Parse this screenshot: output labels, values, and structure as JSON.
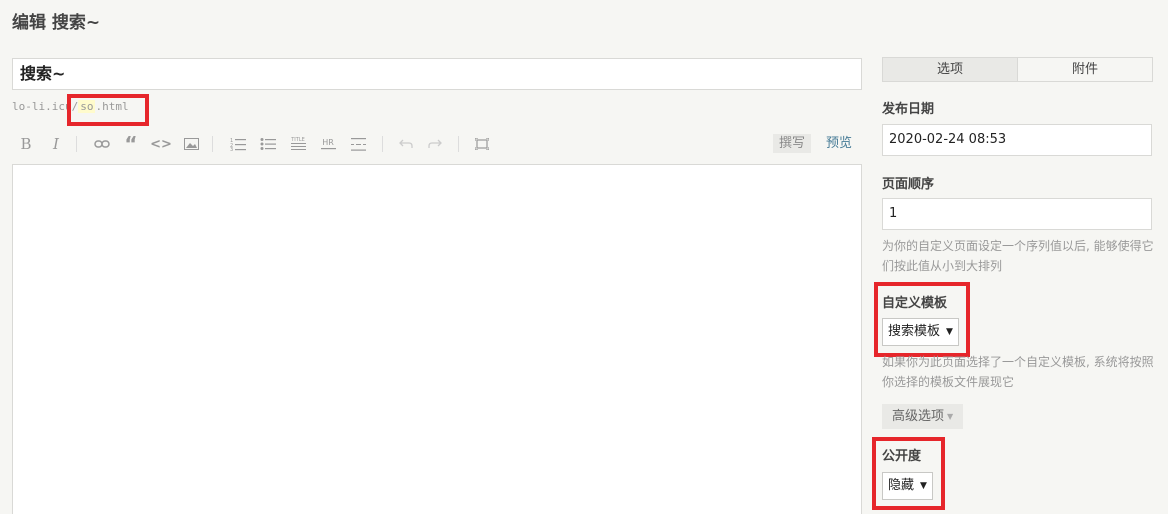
{
  "header": {
    "title": "编辑 搜索~"
  },
  "editor": {
    "title_value": "搜索~",
    "slug_prefix": "lo-li.icu/",
    "slug_value": "so",
    "slug_suffix": ".html",
    "toolbar": {
      "bold": "B",
      "italic": "I",
      "quote": "“",
      "code": "<>",
      "heading": "TITLE",
      "hr": "HR",
      "write_label": "撰写",
      "preview_label": "预览"
    },
    "content": ""
  },
  "sidebar": {
    "tabs": [
      {
        "label": "选项",
        "active": true
      },
      {
        "label": "附件",
        "active": false
      }
    ],
    "publish_date_label": "发布日期",
    "publish_date_value": "2020-02-24 08:53",
    "order_label": "页面顺序",
    "order_value": "1",
    "order_desc": "为你的自定义页面设定一个序列值以后, 能够使得它们按此值从小到大排列",
    "template_label": "自定义模板",
    "template_value": "搜索模板",
    "template_desc": "如果你为此页面选择了一个自定义模板, 系统将按照你选择的模板文件展现它",
    "advanced_label": "高级选项",
    "visibility_label": "公开度",
    "visibility_value": "隐藏"
  },
  "colors": {
    "highlight": "#e6262b",
    "link": "#467b96",
    "background": "#f6f6f3"
  }
}
